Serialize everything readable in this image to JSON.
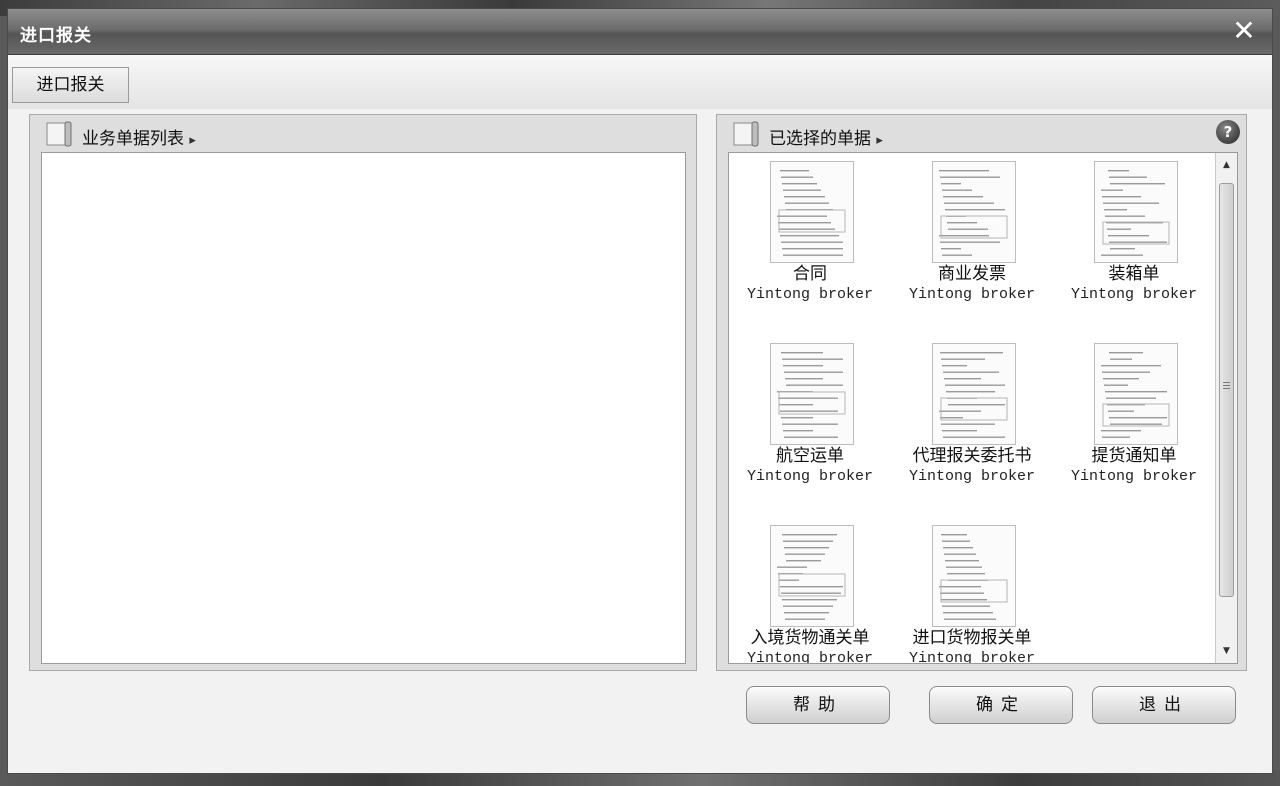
{
  "dialog": {
    "title": "进口报关",
    "close_icon": "close-icon"
  },
  "tabs": [
    {
      "label": "进口报关"
    }
  ],
  "left_panel": {
    "title": "业务单据列表",
    "arrow": "▸"
  },
  "right_panel": {
    "title": "已选择的单据",
    "arrow": "▸",
    "help_glyph": "?",
    "documents": [
      {
        "name": "合同",
        "owner": "Yintong broker"
      },
      {
        "name": "商业发票",
        "owner": "Yintong broker"
      },
      {
        "name": "装箱单",
        "owner": "Yintong broker"
      },
      {
        "name": "航空运单",
        "owner": "Yintong broker"
      },
      {
        "name": "代理报关委托书",
        "owner": "Yintong broker"
      },
      {
        "name": "提货通知单",
        "owner": "Yintong broker"
      },
      {
        "name": "入境货物通关单",
        "owner": "Yintong broker"
      },
      {
        "name": "进口货物报关单",
        "owner": "Yintong broker"
      }
    ],
    "scroll_up": "▲",
    "scroll_down": "▼"
  },
  "buttons": {
    "help": "帮助",
    "confirm": "确定",
    "exit": "退出"
  }
}
